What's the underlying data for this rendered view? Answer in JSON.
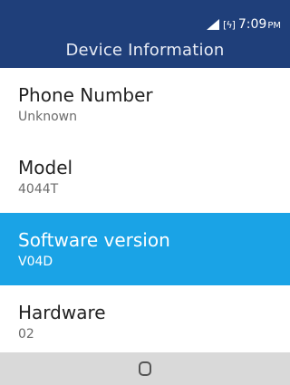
{
  "status_bar": {
    "time": "7:09",
    "ampm": "PM",
    "signal_icon": "signal-strength-icon",
    "battery_icon": "battery-charging-icon",
    "battery_glyph": "[ϟ]"
  },
  "header": {
    "title": "Device Information"
  },
  "items": [
    {
      "label": "Phone Number",
      "value": "Unknown"
    },
    {
      "label": "Model",
      "value": "4044T"
    },
    {
      "label": "Software version",
      "value": "V04D"
    },
    {
      "label": "Hardware",
      "value": "02"
    }
  ],
  "selected_index": 2,
  "nav": {
    "home_icon": "home-button-icon"
  },
  "colors": {
    "header_bg": "#1f3f7a",
    "selected_bg": "#1aa3e6",
    "nav_bg": "#d9d9d9"
  }
}
